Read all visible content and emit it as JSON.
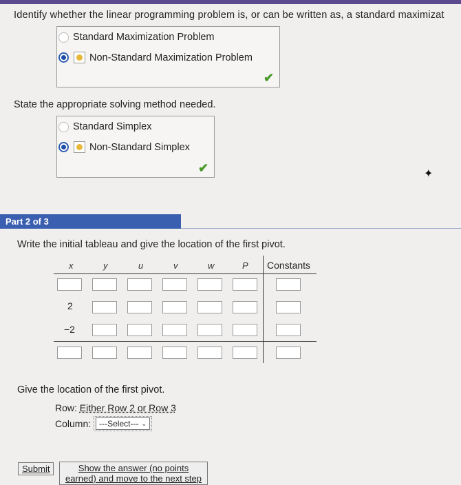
{
  "question1": {
    "prompt": "Identify whether the linear programming problem is, or can be written as, a standard maximizat",
    "options": [
      "Standard Maximization Problem",
      "Non-Standard Maximization Problem"
    ],
    "selected": 1
  },
  "question2": {
    "prompt": "State the appropriate solving method needed.",
    "options": [
      "Standard Simplex",
      "Non-Standard Simplex"
    ],
    "selected": 1
  },
  "part": {
    "label": "Part 2 of 3"
  },
  "question3": {
    "prompt": "Write the initial tableau and give the location of the first pivot."
  },
  "tableau": {
    "columns": [
      "x",
      "y",
      "u",
      "v",
      "w",
      "P"
    ],
    "constants_header": "Constants",
    "row_values": [
      "",
      "2",
      "−2",
      ""
    ]
  },
  "question4": {
    "prompt": "Give the location of the first pivot.",
    "row_label": "Row:",
    "row_answer": "Either Row 2 or Row 3",
    "column_label": "Column:",
    "column_select": "---Select---"
  },
  "buttons": {
    "submit": "Submit",
    "show_answer_line1": "Show the answer (no points",
    "show_answer_line2": "earned) and move to the next step"
  },
  "colors": {
    "accent": "#3a5fb0",
    "check": "#4a9a2a"
  }
}
